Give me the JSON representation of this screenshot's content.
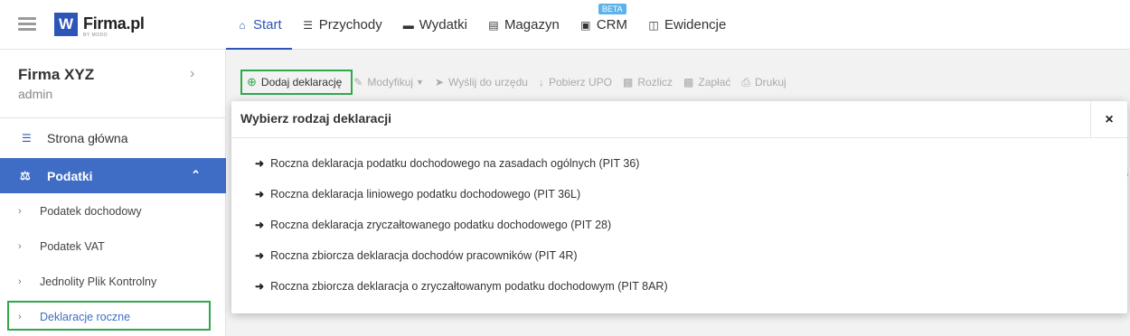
{
  "brand": {
    "name": "Firma.pl",
    "logo_letter": "W",
    "sub": "BY MODO"
  },
  "nav": {
    "items": [
      {
        "label": "Start",
        "icon": "home-icon"
      },
      {
        "label": "Przychody",
        "icon": "coins-icon"
      },
      {
        "label": "Wydatki",
        "icon": "credit-card-icon"
      },
      {
        "label": "Magazyn",
        "icon": "list-icon"
      },
      {
        "label": "CRM",
        "icon": "address-book-icon",
        "badge": "BETA"
      },
      {
        "label": "Ewidencje",
        "icon": "folder-open-icon"
      }
    ],
    "active": "Start"
  },
  "sidebar": {
    "company": "Firma XYZ",
    "user": "admin",
    "home": "Strona główna",
    "section": "Podatki",
    "subitems": [
      "Podatek dochodowy",
      "Podatek VAT",
      "Jednolity Plik Kontrolny",
      "Deklaracje roczne"
    ],
    "active_subitem": "Deklaracje roczne"
  },
  "toolbar": {
    "add": "Dodaj deklarację",
    "modify": "Modyfikuj",
    "send": "Wyślij do urzędu",
    "download": "Pobierz UPO",
    "settle": "Rozlicz",
    "pay": "Zapłać",
    "print": "Drukuj"
  },
  "modal": {
    "title": "Wybierz rodzaj deklaracji",
    "close": "×",
    "options": [
      "Roczna deklaracja podatku dochodowego na zasadach ogólnych (PIT 36)",
      "Roczna deklaracja liniowego podatku dochodowego (PIT 36L)",
      "Roczna deklaracja zryczałtowanego podatku dochodowego (PIT 28)",
      "Roczna zbiorcza deklaracja dochodów pracowników (PIT 4R)",
      "Roczna zbiorcza deklaracja o zryczałtowanym podatku dochodowym (PIT 8AR)"
    ]
  },
  "colors": {
    "brand": "#2d55b8",
    "sidebar_active": "#3f6dc6",
    "highlight": "#2ea84a",
    "beta_badge": "#5cb3ea"
  }
}
